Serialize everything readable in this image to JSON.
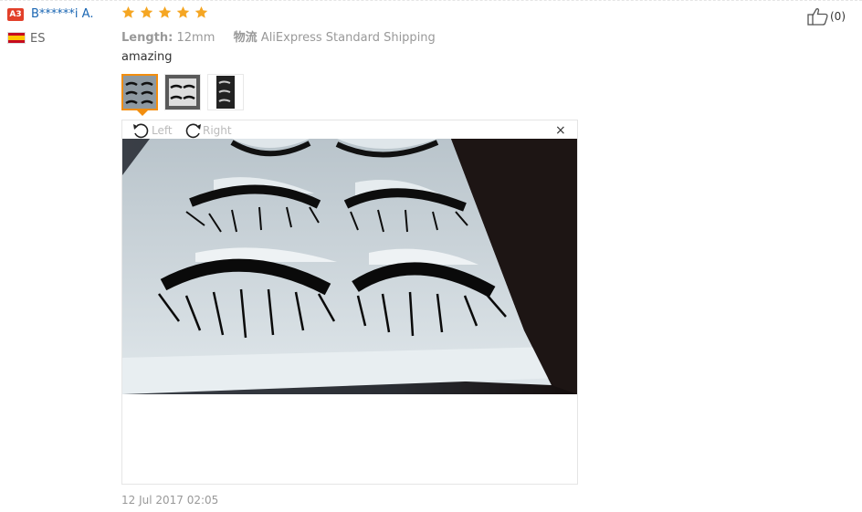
{
  "reviewer": {
    "level_badge": "A3",
    "name": "B******i A.",
    "country_code": "ES"
  },
  "rating": {
    "stars": 5,
    "max": 5,
    "star_color": "#f5a623"
  },
  "like": {
    "count": "(0)"
  },
  "attributes": [
    {
      "key": "Length:",
      "value": "12mm"
    },
    {
      "key": "物流",
      "value": "AliExpress Standard Shipping"
    }
  ],
  "feedback_text": "amazing",
  "thumbnails": [
    {
      "name": "thumb-1",
      "selected": true
    },
    {
      "name": "thumb-2",
      "selected": false
    },
    {
      "name": "thumb-3",
      "selected": false
    }
  ],
  "viewer": {
    "rotate_left_label": "Left",
    "rotate_right_label": "Right",
    "close_glyph": "×"
  },
  "date": "12 Jul 2017 02:05",
  "colors": {
    "accent_orange": "#f28e0f",
    "link_blue": "#1a66b3",
    "badge_red": "#e2402a"
  }
}
